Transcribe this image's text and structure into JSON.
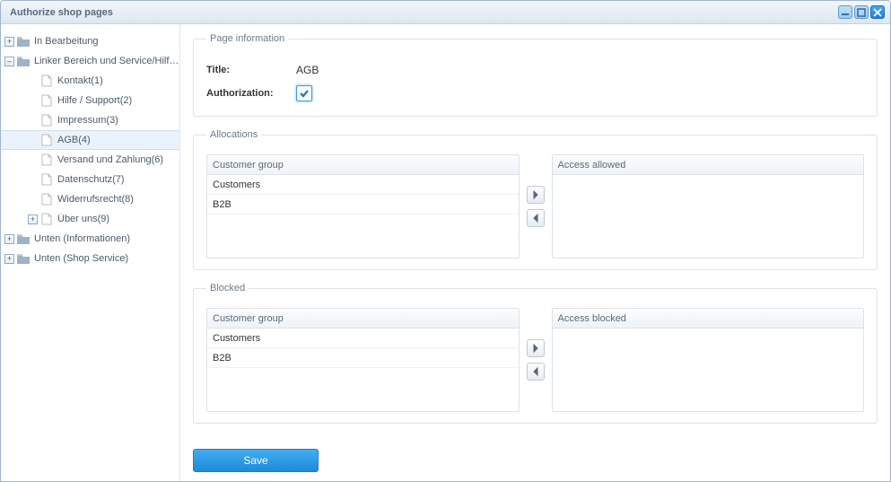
{
  "window": {
    "title": "Authorize shop pages"
  },
  "tree": {
    "roots": [
      {
        "id": "in-bearbeitung",
        "label": "In Bearbeitung",
        "type": "folder",
        "expandable": true,
        "expanded": false
      },
      {
        "id": "linker-bereich",
        "label": "Linker Bereich und Service/Hilfe oben",
        "type": "folder",
        "expandable": true,
        "expanded": true,
        "children": [
          {
            "id": "kontakt",
            "label": "Kontakt(1)",
            "type": "page"
          },
          {
            "id": "hilfe",
            "label": "Hilfe / Support(2)",
            "type": "page"
          },
          {
            "id": "impressum",
            "label": "Impressum(3)",
            "type": "page"
          },
          {
            "id": "agb",
            "label": "AGB(4)",
            "type": "page",
            "selected": true
          },
          {
            "id": "versand",
            "label": "Versand und Zahlung(6)",
            "type": "page"
          },
          {
            "id": "datenschutz",
            "label": "Datenschutz(7)",
            "type": "page"
          },
          {
            "id": "widerruf",
            "label": "Widerrufsrecht(8)",
            "type": "page"
          },
          {
            "id": "ueber-uns",
            "label": "Über uns(9)",
            "type": "page",
            "expandable": true
          }
        ]
      },
      {
        "id": "unten-info",
        "label": "Unten (Informationen)",
        "type": "folder",
        "expandable": true,
        "expanded": false
      },
      {
        "id": "unten-shop",
        "label": "Unten (Shop Service)",
        "type": "folder",
        "expandable": true,
        "expanded": false
      }
    ]
  },
  "pageInfo": {
    "legend": "Page information",
    "titleLabel": "Title:",
    "titleValue": "AGB",
    "authLabel": "Authorization:",
    "authChecked": true
  },
  "allocations": {
    "legend": "Allocations",
    "sourceHeader": "Customer group",
    "sourceItems": [
      "Customers",
      "B2B"
    ],
    "targetHeader": "Access allowed",
    "targetItems": []
  },
  "blocked": {
    "legend": "Blocked",
    "sourceHeader": "Customer group",
    "sourceItems": [
      "Customers",
      "B2B"
    ],
    "targetHeader": "Access blocked",
    "targetItems": []
  },
  "buttons": {
    "save": "Save"
  }
}
